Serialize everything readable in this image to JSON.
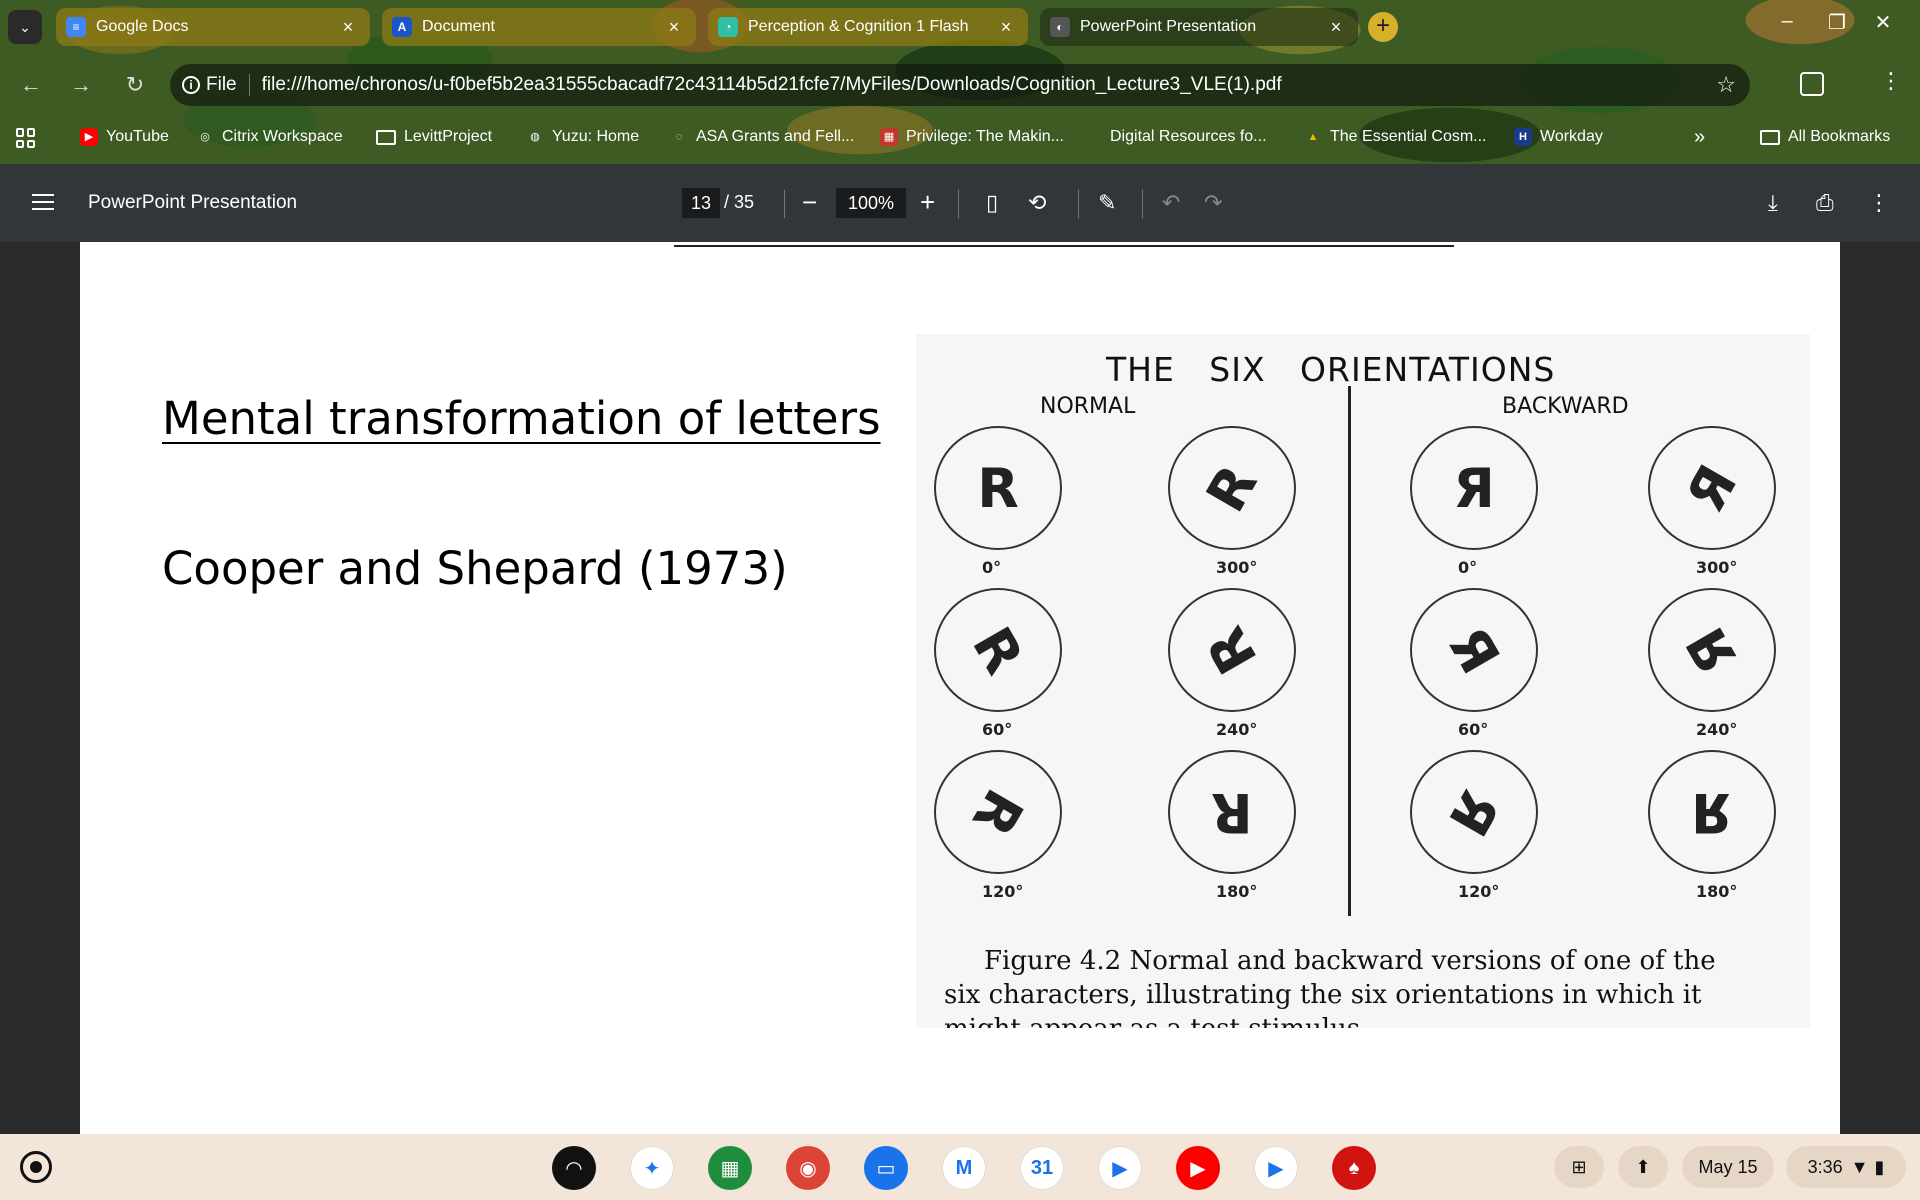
{
  "tabs": [
    {
      "title": "Google Docs",
      "icon": "google-docs-icon",
      "color": "#4285f4",
      "glyph": "≡",
      "close": "×"
    },
    {
      "title": "Document",
      "icon": "document-app-icon",
      "color": "#1a56c8",
      "glyph": "A",
      "close": "×"
    },
    {
      "title": "Perception & Cognition 1 Flash",
      "icon": "flashcard-icon",
      "color": "#2ebfa5",
      "glyph": "◔",
      "close": "×"
    },
    {
      "title": "PowerPoint Presentation",
      "icon": "pdf-tab-icon",
      "color": "#555555",
      "glyph": "◐",
      "close": "×"
    }
  ],
  "omnibox": {
    "scheme_label": "File",
    "url": "file:///home/chronos/u-f0bef5b2ea31555cbacadf72c43114b5d21fcfe7/MyFiles/Downloads/Cognition_Lecture3_VLE(1).pdf"
  },
  "bookmarks": [
    {
      "label": "YouTube",
      "icon": "youtube-icon",
      "color": "#ff0000",
      "glyph": "▶"
    },
    {
      "label": "Citrix Workspace",
      "icon": "citrix-icon",
      "color": "#444444",
      "glyph": "◎"
    },
    {
      "label": "LevittProject",
      "icon": "folder-icon",
      "color": "",
      "glyph": ""
    },
    {
      "label": "Yuzu: Home",
      "icon": "globe-icon",
      "color": "#666666",
      "glyph": "◍"
    },
    {
      "label": "ASA Grants and Fell...",
      "icon": "asa-icon",
      "color": "#2b4c8c",
      "glyph": "◌"
    },
    {
      "label": "Privilege: The Makin...",
      "icon": "book-icon",
      "color": "#c0392b",
      "glyph": "▦"
    },
    {
      "label": "Digital Resources fo...",
      "icon": "blank-page-icon",
      "color": "",
      "glyph": ""
    },
    {
      "label": "The Essential Cosm...",
      "icon": "drive-icon",
      "color": "#f4b400",
      "glyph": "▲"
    },
    {
      "label": "Workday",
      "icon": "workday-icon",
      "color": "#1a3a8c",
      "glyph": "H"
    }
  ],
  "bookmarks_overflow": "»",
  "all_bookmarks": "All Bookmarks",
  "pdf_toolbar": {
    "title": "PowerPoint Presentation",
    "current_page": "13",
    "total_pages": "/ 35",
    "zoom": "100%",
    "zoom_out": "−",
    "zoom_in": "+"
  },
  "slide": {
    "heading": "Mental transformation of letters",
    "citation": "Cooper and Shepard (1973)"
  },
  "figure": {
    "title": "THE   SIX   ORIENTATIONS",
    "normal_label": "NORMAL",
    "backward_label": "BACKWARD",
    "glyph": "R",
    "mirror_glyph": "Я",
    "discs": [
      {
        "deg": "0°",
        "mirrored": false,
        "rotation": 0
      },
      {
        "deg": "300°",
        "mirrored": false,
        "rotation": 300
      },
      {
        "deg": "0°",
        "mirrored": true,
        "rotation": 0
      },
      {
        "deg": "300°",
        "mirrored": true,
        "rotation": 300
      },
      {
        "deg": "60°",
        "mirrored": false,
        "rotation": 60
      },
      {
        "deg": "240°",
        "mirrored": false,
        "rotation": 240
      },
      {
        "deg": "60°",
        "mirrored": true,
        "rotation": 60
      },
      {
        "deg": "240°",
        "mirrored": true,
        "rotation": 240
      },
      {
        "deg": "120°",
        "mirrored": false,
        "rotation": 120
      },
      {
        "deg": "180°",
        "mirrored": false,
        "rotation": 180
      },
      {
        "deg": "120°",
        "mirrored": true,
        "rotation": 120
      },
      {
        "deg": "180°",
        "mirrored": true,
        "rotation": 180
      }
    ],
    "caption_line1": "Figure 4.2  Normal and backward versions of one of the",
    "caption_line2": "six characters, illustrating the six orientations in which it",
    "caption_line3": "might appear as a test stimulus."
  },
  "shelf": {
    "apps": [
      {
        "name": "chromebook-perks-icon",
        "color": "#111111",
        "glyph": "◠"
      },
      {
        "name": "gemini-icon",
        "color": "#ffffff",
        "glyph": "✦"
      },
      {
        "name": "app-launcher-grid-icon",
        "color": "#1e8e3e",
        "glyph": "▦"
      },
      {
        "name": "chrome-icon",
        "color": "#db4437",
        "glyph": "◉"
      },
      {
        "name": "files-icon",
        "color": "#1a73e8",
        "glyph": "▭"
      },
      {
        "name": "gmail-icon",
        "color": "#ffffff",
        "glyph": "M"
      },
      {
        "name": "calendar-icon",
        "color": "#ffffff",
        "glyph": "31"
      },
      {
        "name": "meet-icon",
        "color": "#ffffff",
        "glyph": "▶"
      },
      {
        "name": "youtube-app-icon",
        "color": "#ff0000",
        "glyph": "▶"
      },
      {
        "name": "play-store-icon",
        "color": "#ffffff",
        "glyph": "▶"
      },
      {
        "name": "acrobat-icon",
        "color": "#d1140f",
        "glyph": "♠"
      }
    ],
    "date": "May 15",
    "time": "3:36"
  }
}
